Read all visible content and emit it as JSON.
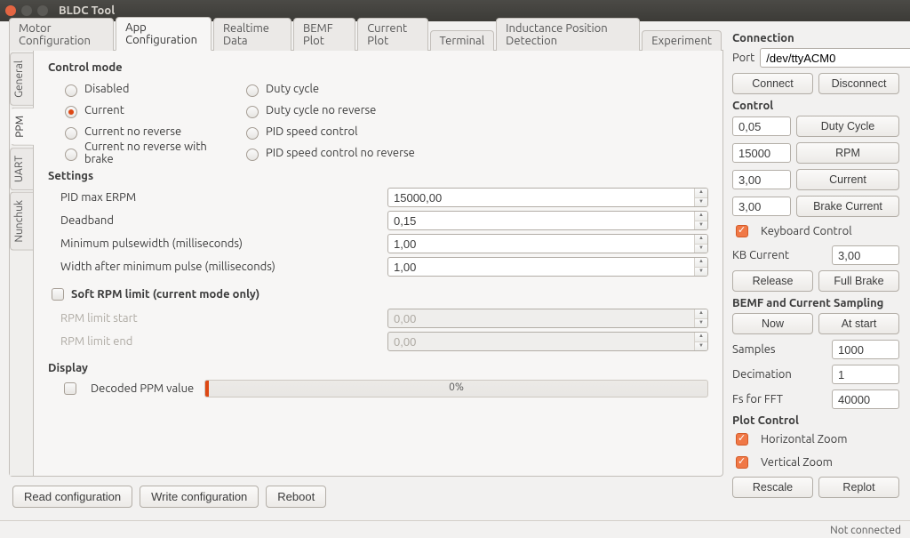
{
  "window": {
    "title": "BLDC Tool"
  },
  "tabs": {
    "top": [
      "Motor Configuration",
      "App Configuration",
      "Realtime Data",
      "BEMF Plot",
      "Current Plot",
      "Terminal",
      "Inductance Position Detection",
      "Experiment"
    ],
    "active_top": 1,
    "side": [
      "General",
      "PPM",
      "UART",
      "Nunchuk"
    ],
    "active_side": 1
  },
  "control_mode": {
    "title": "Control mode",
    "options": [
      "Disabled",
      "Current",
      "Current no reverse",
      "Current no reverse with brake",
      "Duty cycle",
      "Duty cycle no reverse",
      "PID speed control",
      "PID speed control no reverse"
    ],
    "selected": 1
  },
  "settings": {
    "title": "Settings",
    "pid_max_erpm": {
      "label": "PID max ERPM",
      "value": "15000,00"
    },
    "deadband": {
      "label": "Deadband",
      "value": "0,15"
    },
    "min_pulsewidth": {
      "label": "Minimum pulsewidth (milliseconds)",
      "value": "1,00"
    },
    "width_after_min": {
      "label": "Width after minimum pulse (milliseconds)",
      "value": "1,00"
    }
  },
  "soft_rpm": {
    "label": "Soft RPM limit (current mode only)",
    "checked": false,
    "start": {
      "label": "RPM limit start",
      "value": "0,00"
    },
    "end": {
      "label": "RPM limit end",
      "value": "0,00"
    }
  },
  "display": {
    "title": "Display",
    "decoded_ppm": {
      "label": "Decoded PPM value",
      "checked": false,
      "percent": "0%"
    }
  },
  "bottom_buttons": {
    "read": "Read configuration",
    "write": "Write configuration",
    "reboot": "Reboot"
  },
  "connection": {
    "title": "Connection",
    "port_label": "Port",
    "port_value": "/dev/ttyACM0",
    "connect": "Connect",
    "disconnect": "Disconnect"
  },
  "control_panel": {
    "title": "Control",
    "duty": {
      "value": "0,05",
      "btn": "Duty Cycle"
    },
    "rpm": {
      "value": "15000",
      "btn": "RPM"
    },
    "current": {
      "value": "3,00",
      "btn": "Current"
    },
    "brake_current": {
      "value": "3,00",
      "btn": "Brake Current"
    },
    "keyboard": {
      "label": "Keyboard Control",
      "checked": true
    },
    "kb_current": {
      "label": "KB Current",
      "value": "3,00"
    },
    "release": "Release",
    "full_brake": "Full Brake"
  },
  "bemf": {
    "title": "BEMF and Current Sampling",
    "now": "Now",
    "at_start": "At start",
    "samples": {
      "label": "Samples",
      "value": "1000"
    },
    "decimation": {
      "label": "Decimation",
      "value": "1"
    },
    "fs_fft": {
      "label": "Fs for FFT",
      "value": "40000"
    }
  },
  "plot": {
    "title": "Plot Control",
    "hzoom": {
      "label": "Horizontal Zoom",
      "checked": true
    },
    "vzoom": {
      "label": "Vertical Zoom",
      "checked": true
    },
    "rescale": "Rescale",
    "replot": "Replot"
  },
  "status": {
    "text": "Not connected"
  }
}
